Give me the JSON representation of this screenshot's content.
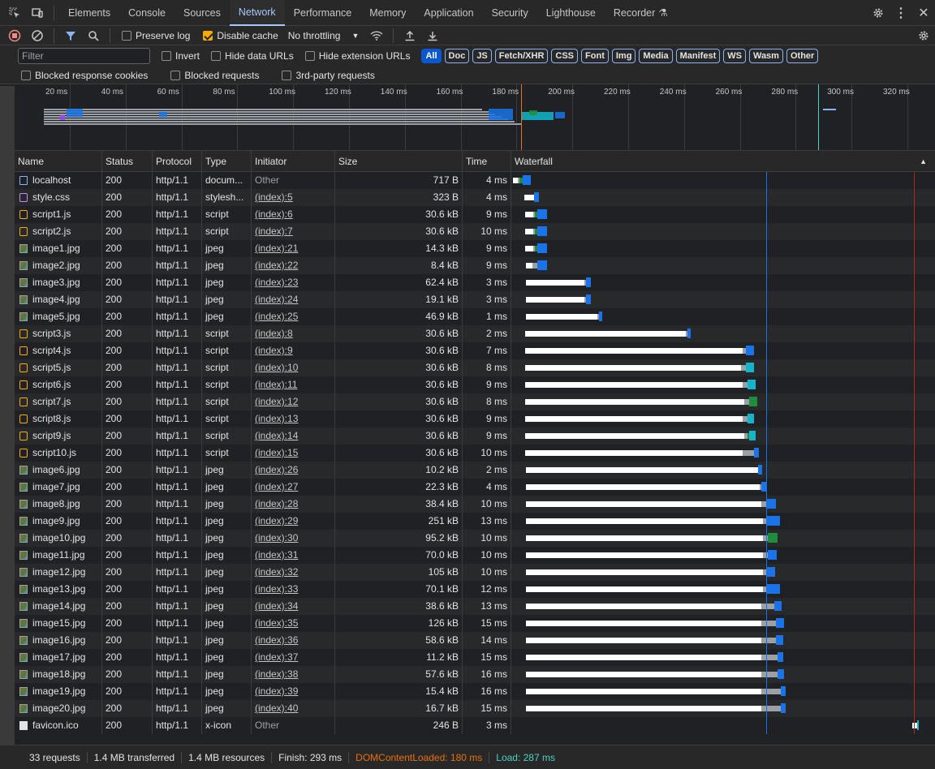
{
  "tabs": [
    {
      "label": "Elements"
    },
    {
      "label": "Console"
    },
    {
      "label": "Sources"
    },
    {
      "label": "Network",
      "active": true
    },
    {
      "label": "Performance"
    },
    {
      "label": "Memory"
    },
    {
      "label": "Application"
    },
    {
      "label": "Security"
    },
    {
      "label": "Lighthouse"
    },
    {
      "label": "Recorder"
    }
  ],
  "toolbar": {
    "preserve_log": "Preserve log",
    "disable_cache": "Disable cache",
    "disable_cache_checked": true,
    "throttling": "No throttling"
  },
  "filter": {
    "placeholder": "Filter",
    "invert": "Invert",
    "hide_data_urls": "Hide data URLs",
    "hide_extension_urls": "Hide extension URLs",
    "types": [
      "All",
      "Doc",
      "JS",
      "Fetch/XHR",
      "CSS",
      "Font",
      "Img",
      "Media",
      "Manifest",
      "WS",
      "Wasm",
      "Other"
    ],
    "blocked_cookies": "Blocked response cookies",
    "blocked_requests": "Blocked requests",
    "third_party": "3rd-party requests"
  },
  "overview_ticks": [
    "20 ms",
    "40 ms",
    "60 ms",
    "80 ms",
    "100 ms",
    "120 ms",
    "140 ms",
    "160 ms",
    "180 ms",
    "200 ms",
    "220 ms",
    "240 ms",
    "260 ms",
    "280 ms",
    "300 ms",
    "320 ms"
  ],
  "columns": {
    "name": "Name",
    "status": "Status",
    "protocol": "Protocol",
    "type": "Type",
    "initiator": "Initiator",
    "size": "Size",
    "time": "Time",
    "waterfall": "Waterfall"
  },
  "rows": [
    {
      "name": "localhost",
      "status": "200",
      "protocol": "http/1.1",
      "type": "docum...",
      "initiator": "Other",
      "size": "717 B",
      "time": "4 ms",
      "icon": "doc"
    },
    {
      "name": "style.css",
      "status": "200",
      "protocol": "http/1.1",
      "type": "stylesh...",
      "initiator": "(index):5",
      "size": "323 B",
      "time": "4 ms",
      "icon": "css"
    },
    {
      "name": "script1.js",
      "status": "200",
      "protocol": "http/1.1",
      "type": "script",
      "initiator": "(index):6",
      "size": "30.6 kB",
      "time": "9 ms",
      "icon": "js"
    },
    {
      "name": "script2.js",
      "status": "200",
      "protocol": "http/1.1",
      "type": "script",
      "initiator": "(index):7",
      "size": "30.6 kB",
      "time": "10 ms",
      "icon": "js"
    },
    {
      "name": "image1.jpg",
      "status": "200",
      "protocol": "http/1.1",
      "type": "jpeg",
      "initiator": "(index):21",
      "size": "14.3 kB",
      "time": "9 ms",
      "icon": "img"
    },
    {
      "name": "image2.jpg",
      "status": "200",
      "protocol": "http/1.1",
      "type": "jpeg",
      "initiator": "(index):22",
      "size": "8.4 kB",
      "time": "9 ms",
      "icon": "img"
    },
    {
      "name": "image3.jpg",
      "status": "200",
      "protocol": "http/1.1",
      "type": "jpeg",
      "initiator": "(index):23",
      "size": "62.4 kB",
      "time": "3 ms",
      "icon": "img"
    },
    {
      "name": "image4.jpg",
      "status": "200",
      "protocol": "http/1.1",
      "type": "jpeg",
      "initiator": "(index):24",
      "size": "19.1 kB",
      "time": "3 ms",
      "icon": "img"
    },
    {
      "name": "image5.jpg",
      "status": "200",
      "protocol": "http/1.1",
      "type": "jpeg",
      "initiator": "(index):25",
      "size": "46.9 kB",
      "time": "1 ms",
      "icon": "img"
    },
    {
      "name": "script3.js",
      "status": "200",
      "protocol": "http/1.1",
      "type": "script",
      "initiator": "(index):8",
      "size": "30.6 kB",
      "time": "2 ms",
      "icon": "js"
    },
    {
      "name": "script4.js",
      "status": "200",
      "protocol": "http/1.1",
      "type": "script",
      "initiator": "(index):9",
      "size": "30.6 kB",
      "time": "7 ms",
      "icon": "js"
    },
    {
      "name": "script5.js",
      "status": "200",
      "protocol": "http/1.1",
      "type": "script",
      "initiator": "(index):10",
      "size": "30.6 kB",
      "time": "8 ms",
      "icon": "js"
    },
    {
      "name": "script6.js",
      "status": "200",
      "protocol": "http/1.1",
      "type": "script",
      "initiator": "(index):11",
      "size": "30.6 kB",
      "time": "9 ms",
      "icon": "js"
    },
    {
      "name": "script7.js",
      "status": "200",
      "protocol": "http/1.1",
      "type": "script",
      "initiator": "(index):12",
      "size": "30.6 kB",
      "time": "8 ms",
      "icon": "js"
    },
    {
      "name": "script8.js",
      "status": "200",
      "protocol": "http/1.1",
      "type": "script",
      "initiator": "(index):13",
      "size": "30.6 kB",
      "time": "9 ms",
      "icon": "js"
    },
    {
      "name": "script9.js",
      "status": "200",
      "protocol": "http/1.1",
      "type": "script",
      "initiator": "(index):14",
      "size": "30.6 kB",
      "time": "9 ms",
      "icon": "js"
    },
    {
      "name": "script10.js",
      "status": "200",
      "protocol": "http/1.1",
      "type": "script",
      "initiator": "(index):15",
      "size": "30.6 kB",
      "time": "10 ms",
      "icon": "js"
    },
    {
      "name": "image6.jpg",
      "status": "200",
      "protocol": "http/1.1",
      "type": "jpeg",
      "initiator": "(index):26",
      "size": "10.2 kB",
      "time": "2 ms",
      "icon": "img"
    },
    {
      "name": "image7.jpg",
      "status": "200",
      "protocol": "http/1.1",
      "type": "jpeg",
      "initiator": "(index):27",
      "size": "22.3 kB",
      "time": "4 ms",
      "icon": "img"
    },
    {
      "name": "image8.jpg",
      "status": "200",
      "protocol": "http/1.1",
      "type": "jpeg",
      "initiator": "(index):28",
      "size": "38.4 kB",
      "time": "10 ms",
      "icon": "img"
    },
    {
      "name": "image9.jpg",
      "status": "200",
      "protocol": "http/1.1",
      "type": "jpeg",
      "initiator": "(index):29",
      "size": "251 kB",
      "time": "13 ms",
      "icon": "img"
    },
    {
      "name": "image10.jpg",
      "status": "200",
      "protocol": "http/1.1",
      "type": "jpeg",
      "initiator": "(index):30",
      "size": "95.2 kB",
      "time": "10 ms",
      "icon": "img"
    },
    {
      "name": "image11.jpg",
      "status": "200",
      "protocol": "http/1.1",
      "type": "jpeg",
      "initiator": "(index):31",
      "size": "70.0 kB",
      "time": "10 ms",
      "icon": "img"
    },
    {
      "name": "image12.jpg",
      "status": "200",
      "protocol": "http/1.1",
      "type": "jpeg",
      "initiator": "(index):32",
      "size": "105 kB",
      "time": "10 ms",
      "icon": "img"
    },
    {
      "name": "image13.jpg",
      "status": "200",
      "protocol": "http/1.1",
      "type": "jpeg",
      "initiator": "(index):33",
      "size": "70.1 kB",
      "time": "12 ms",
      "icon": "img"
    },
    {
      "name": "image14.jpg",
      "status": "200",
      "protocol": "http/1.1",
      "type": "jpeg",
      "initiator": "(index):34",
      "size": "38.6 kB",
      "time": "13 ms",
      "icon": "img"
    },
    {
      "name": "image15.jpg",
      "status": "200",
      "protocol": "http/1.1",
      "type": "jpeg",
      "initiator": "(index):35",
      "size": "126 kB",
      "time": "15 ms",
      "icon": "img"
    },
    {
      "name": "image16.jpg",
      "status": "200",
      "protocol": "http/1.1",
      "type": "jpeg",
      "initiator": "(index):36",
      "size": "58.6 kB",
      "time": "14 ms",
      "icon": "img"
    },
    {
      "name": "image17.jpg",
      "status": "200",
      "protocol": "http/1.1",
      "type": "jpeg",
      "initiator": "(index):37",
      "size": "11.2 kB",
      "time": "15 ms",
      "icon": "img"
    },
    {
      "name": "image18.jpg",
      "status": "200",
      "protocol": "http/1.1",
      "type": "jpeg",
      "initiator": "(index):38",
      "size": "57.6 kB",
      "time": "16 ms",
      "icon": "img"
    },
    {
      "name": "image19.jpg",
      "status": "200",
      "protocol": "http/1.1",
      "type": "jpeg",
      "initiator": "(index):39",
      "size": "15.4 kB",
      "time": "16 ms",
      "icon": "img"
    },
    {
      "name": "image20.jpg",
      "status": "200",
      "protocol": "http/1.1",
      "type": "jpeg",
      "initiator": "(index):40",
      "size": "16.7 kB",
      "time": "15 ms",
      "icon": "img"
    },
    {
      "name": "favicon.ico",
      "status": "200",
      "protocol": "http/1.1",
      "type": "x-icon",
      "initiator": "Other",
      "size": "246 B",
      "time": "3 ms",
      "icon": "ico"
    }
  ],
  "status": {
    "requests": "33 requests",
    "transferred": "1.4 MB transferred",
    "resources": "1.4 MB resources",
    "finish": "Finish: 293 ms",
    "dcl": "DOMContentLoaded: 180 ms",
    "load": "Load: 287 ms"
  },
  "colors": {
    "dcl": "#e8710a",
    "load": "#4fd1c5",
    "accent": "#a8c7fa"
  }
}
